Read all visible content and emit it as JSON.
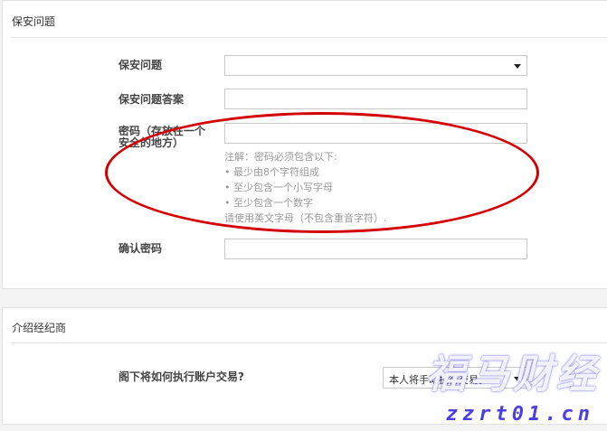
{
  "security_section": {
    "title": "保安问题",
    "question_label": "保安问题",
    "question_value": "",
    "answer_label": "保安问题答案",
    "answer_value": "",
    "password_label_line1": "密码（存放在一个",
    "password_label_line2": "安全的地方）",
    "password_value": "",
    "password_hints": [
      "注解：密码必须包含以下:",
      "• 最少由8个字符组成",
      "• 至少包含一个小写字母",
      "• 至少包含一个数字",
      "请使用英文字母（不包含重音字符）."
    ],
    "confirm_label": "确认密码",
    "confirm_value": ""
  },
  "broker_section": {
    "title": "介绍经纪商",
    "execution_label": "阁下将如何执行账户交易?",
    "execution_value": "本人将手动执行交易。"
  },
  "watermark": {
    "line1": "福马财经",
    "line2": "zzrt01.cn"
  },
  "colors": {
    "annotation": "#d40000",
    "watermark_blue": "#4a3fe0"
  }
}
